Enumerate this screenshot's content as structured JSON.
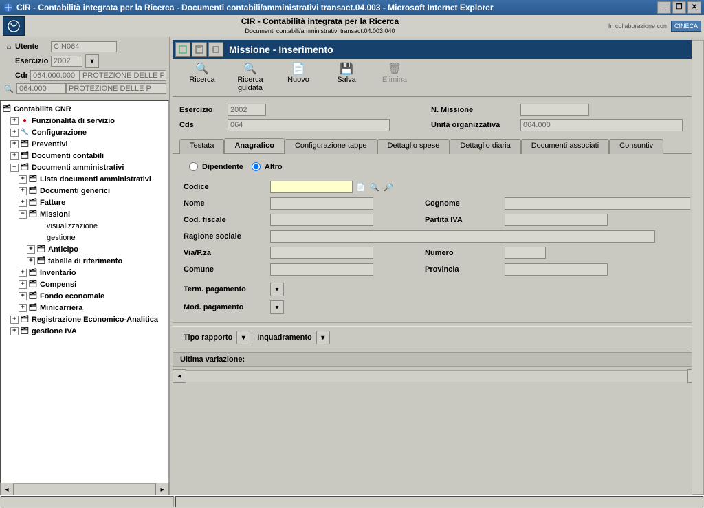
{
  "window": {
    "title": "CIR - Contabilità integrata per la Ricerca - Documenti contabili/amministrativi transact.04.003 - Microsoft Internet Explorer"
  },
  "header": {
    "app_title": "CIR - Contabilità integrata per la Ricerca",
    "sub_title": "Documenti contabili/amministrativi transact.04.003.040",
    "collab_text": "In collaborazione con",
    "cineca": "CINECA"
  },
  "left_panel": {
    "utente_label": "Utente",
    "utente_value": "CIN064",
    "esercizio_label": "Esercizio",
    "esercizio_value": "2002",
    "cdr_label": "Cdr",
    "cdr_value": "064.000.000",
    "cdr_desc": "PROTEZIONE DELLE P",
    "bino_value": "064.000",
    "bino_desc": "PROTEZIONE DELLE P"
  },
  "tree": {
    "root": "Contabilita CNR",
    "funzionalita": "Funzionalità di servizio",
    "configurazione": "Configurazione",
    "preventivi": "Preventivi",
    "doc_contabili": "Documenti contabili",
    "doc_amministrativi": "Documenti amministrativi",
    "lista_doc": "Lista documenti amministrativi",
    "doc_generici": "Documenti generici",
    "fatture": "Fatture",
    "missioni": "Missioni",
    "visualizzazione": "visualizzazione",
    "gestione": "gestione",
    "anticipo": "Anticipo",
    "tabelle_rif": "tabelle di riferimento",
    "inventario": "Inventario",
    "compensi": "Compensi",
    "fondo_economale": "Fondo economale",
    "minicarriera": "Minicarriera",
    "registrazione": "Registrazione Economico-Analitica",
    "gestione_iva": "gestione IVA"
  },
  "page": {
    "title": "Missione - Inserimento"
  },
  "toolbar": {
    "ricerca": "Ricerca",
    "ricerca_guidata_l1": "Ricerca",
    "ricerca_guidata_l2": "guidata",
    "nuovo": "Nuovo",
    "salva": "Salva",
    "elimina": "Elimina"
  },
  "form_top": {
    "esercizio_label": "Esercizio",
    "esercizio_value": "2002",
    "n_missione_label": "N. Missione",
    "n_missione_value": "",
    "cds_label": "Cds",
    "cds_value": "064",
    "uo_label": "Unità organizzativa",
    "uo_value": "064.000"
  },
  "tabs": {
    "testata": "Testata",
    "anagrafico": "Anagrafico",
    "config_tappe": "Configurazione tappe",
    "dettaglio_spese": "Dettaglio spese",
    "dettaglio_diaria": "Dettaglio diaria",
    "doc_associati": "Documenti associati",
    "consuntivo": "Consuntiv"
  },
  "anagrafico": {
    "radio_dipendente": "Dipendente",
    "radio_altro": "Altro",
    "codice": "Codice",
    "nome": "Nome",
    "cognome": "Cognome",
    "cod_fiscale": "Cod. fiscale",
    "partita_iva": "Partita IVA",
    "ragione_sociale": "Ragione sociale",
    "via": "Via/P.za",
    "numero": "Numero",
    "comune": "Comune",
    "provincia": "Provincia",
    "term_pagamento": "Term. pagamento",
    "mod_pagamento": "Mod. pagamento"
  },
  "bottom": {
    "tipo_rapporto": "Tipo rapporto",
    "inquadramento": "Inquadramento"
  },
  "variation": {
    "label": "Ultima variazione:"
  }
}
